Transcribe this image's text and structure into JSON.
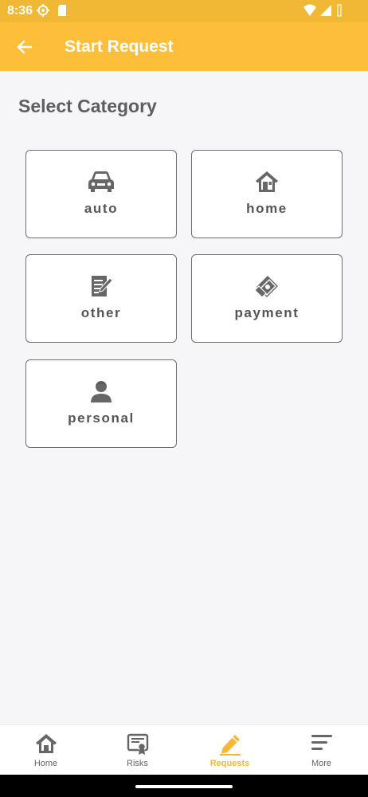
{
  "status": {
    "time": "8:36"
  },
  "app_bar": {
    "title": "Start Request"
  },
  "section": {
    "title": "Select Category"
  },
  "categories": [
    {
      "label": "auto",
      "icon": "car-icon"
    },
    {
      "label": "home",
      "icon": "house-icon"
    },
    {
      "label": "other",
      "icon": "document-edit-icon"
    },
    {
      "label": "payment",
      "icon": "money-icon"
    },
    {
      "label": "personal",
      "icon": "person-icon"
    }
  ],
  "bottom_nav": {
    "items": [
      {
        "label": "Home",
        "icon": "home-icon"
      },
      {
        "label": "Risks",
        "icon": "certificate-icon"
      },
      {
        "label": "Requests",
        "icon": "pencil-icon",
        "active": true
      },
      {
        "label": "More",
        "icon": "menu-icon"
      }
    ]
  },
  "colors": {
    "accent": "#fdbf3a",
    "status_bar": "#f0b835",
    "active_nav": "#f7b733",
    "text_gray": "#5e5e62"
  }
}
